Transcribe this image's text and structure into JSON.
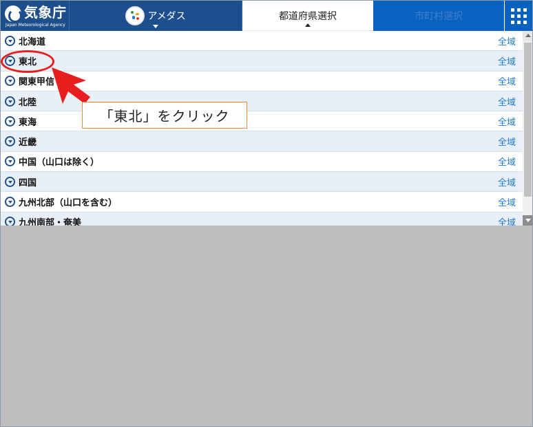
{
  "header": {
    "logo_name": "気象庁",
    "logo_sub": "Japan Meteorological Agency",
    "tabs": [
      {
        "label": "アメダス"
      },
      {
        "label": "都道府県選択"
      },
      {
        "label": "市町村選択"
      }
    ]
  },
  "regions": [
    {
      "label": "北海道",
      "link": "全域"
    },
    {
      "label": "東北",
      "link": "全域"
    },
    {
      "label": "関東甲信",
      "link": "全域"
    },
    {
      "label": "北陸",
      "link": "全域"
    },
    {
      "label": "東海",
      "link": "全域"
    },
    {
      "label": "近畿",
      "link": "全域"
    },
    {
      "label": "中国（山口は除く）",
      "link": "全域"
    },
    {
      "label": "四国",
      "link": "全域"
    },
    {
      "label": "九州北部（山口を含む）",
      "link": "全域"
    },
    {
      "label": "九州南部・奄美",
      "link": "全域"
    }
  ],
  "annotation": {
    "text": "「東北」をクリック"
  },
  "colors": {
    "brand_navy": "#1d4f8c",
    "tab_blue": "#0a62c0",
    "link_blue": "#1e7bd6",
    "annotation_red": "#e81d1d"
  },
  "icons": {
    "logo": "jma-logo-icon",
    "amedas": "amedas-map-icon",
    "menu": "grid-menu-icon",
    "row": "chevron-down-circle-icon"
  }
}
